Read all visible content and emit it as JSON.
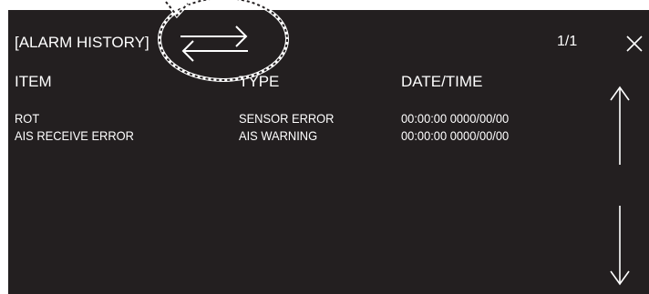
{
  "dialog": {
    "title": "[ALARM HISTORY]",
    "page_indicator": "1/1"
  },
  "columns": [
    "ITEM",
    "TYPE",
    "DATE/TIME"
  ],
  "rows": [
    {
      "item": "ROT",
      "type": "SENSOR ERROR",
      "datetime": "00:00:00  0000/00/00"
    },
    {
      "item": "AIS RECEIVE ERROR",
      "type": "AIS WARNING",
      "datetime": "00:00:00  0000/00/00"
    }
  ],
  "icons": {
    "switch": "swap-arrows-icon",
    "close": "close-icon",
    "scroll_up": "arrow-up-icon",
    "scroll_down": "arrow-down-icon",
    "callout": "dashed-callout-circle"
  },
  "colors": {
    "screen_background": "#231f20",
    "text": "#ffffff"
  }
}
